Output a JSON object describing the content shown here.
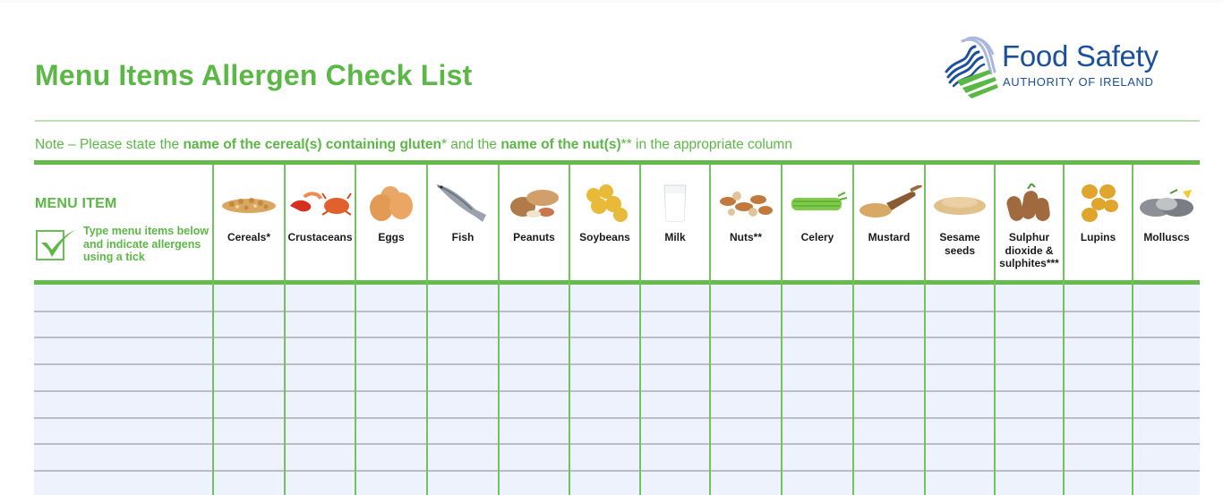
{
  "page": {
    "title": "Menu Items Allergen Check List"
  },
  "logo": {
    "brand": "Food Safety",
    "subtitle": "AUTHORITY OF IRELAND",
    "icon": "fsai-wave-logo-icon"
  },
  "note": {
    "prefix": "Note – Please state the ",
    "bold1": "name of the cereal(s) containing gluten",
    "star1": "*",
    "middle": " and the ",
    "bold2": "name of the nut(s)",
    "star2": "**",
    "suffix": " in the appropriate column"
  },
  "table": {
    "menu_column": {
      "heading": "MENU ITEM",
      "instruction": "Type menu items below and indicate allergens using a tick",
      "icon": "checkbox-tick-icon"
    },
    "allergens": [
      {
        "label": "Cereals*",
        "icon": "cereals-icon"
      },
      {
        "label": "Crustaceans",
        "icon": "crustaceans-icon"
      },
      {
        "label": "Eggs",
        "icon": "eggs-icon"
      },
      {
        "label": "Fish",
        "icon": "fish-icon"
      },
      {
        "label": "Peanuts",
        "icon": "peanuts-icon"
      },
      {
        "label": "Soybeans",
        "icon": "soybeans-icon"
      },
      {
        "label": "Milk",
        "icon": "milk-icon"
      },
      {
        "label": "Nuts**",
        "icon": "nuts-icon"
      },
      {
        "label": "Celery",
        "icon": "celery-icon"
      },
      {
        "label": "Mustard",
        "icon": "mustard-icon"
      },
      {
        "label": "Sesame seeds",
        "icon": "sesame-seeds-icon"
      },
      {
        "label": "Sulphur dioxide & sulphites***",
        "icon": "sulphites-icon"
      },
      {
        "label": "Lupins",
        "icon": "lupins-icon"
      },
      {
        "label": "Molluscs",
        "icon": "molluscs-icon"
      }
    ],
    "rows": [
      "",
      "",
      "",
      "",
      "",
      "",
      "",
      ""
    ]
  },
  "colors": {
    "accent_green": "#5cb846",
    "border_green": "#66bb4f",
    "brand_blue": "#1c4f9c",
    "row_fill": "#eef2fd"
  }
}
